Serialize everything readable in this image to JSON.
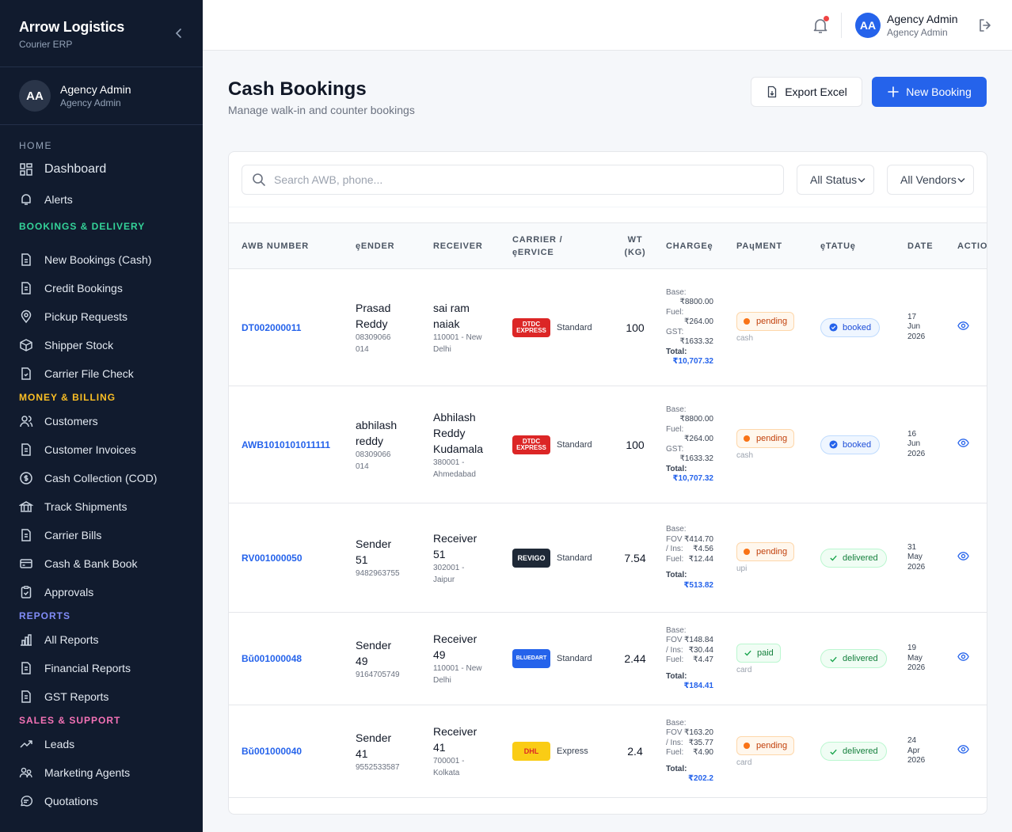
{
  "brand": {
    "title": "Arrow Logistics",
    "subtitle": "Courier ERP"
  },
  "user": {
    "initials": "AA",
    "name": "Agency Admin",
    "role": "Agency Admin"
  },
  "nav": {
    "home": "HOME",
    "dashboard": "Dashboard",
    "alerts": "Alerts",
    "bookings_section": "BOOKINGS & DELIVERY",
    "new_bookings": "New Bookings (Cash)",
    "credit_bookings": "Credit Bookings",
    "pickup_requests": "Pickup Requests",
    "shipper_stock": "Shipper Stock",
    "carrier_file_check": "Carrier File Check",
    "money_section": "MONEY & BILLING",
    "customers": "Customers",
    "customer_invoices": "Customer Invoices",
    "cash_collection": "Cash Collection (COD)",
    "track_shipments": "Track Shipments",
    "carrier_bills": "Carrier Bills",
    "cash_bank_book": "Cash & Bank Book",
    "approvals": "Approvals",
    "reports_section": "REPORTS",
    "all_reports": "All Reports",
    "financial_reports": "Financial Reports",
    "gst_reports": "GST Reports",
    "sales_section": "SALES & SUPPORT",
    "leads": "Leads",
    "marketing_agents": "Marketing Agents",
    "quotations": "Quotations"
  },
  "page": {
    "title": "Cash Bookings",
    "subtitle": "Manage walk-in and counter bookings",
    "export_label": "Export Excel",
    "new_label": "New Booking"
  },
  "filters": {
    "search_placeholder": "Search AWB, phone...",
    "status": "All Status",
    "vendors": "All Vendors"
  },
  "table": {
    "headers": {
      "awb": "AWB NUMBER",
      "sender": "ȩENDER",
      "receiver": "RECEIVER",
      "carrier_1": "CARRIER /",
      "carrier_2": "ȩERVICE",
      "wt_1": "WT",
      "wt_2": "(KG)",
      "charges": "CHARGEȩ",
      "payment": "PAɥMENT",
      "status": "ȩTATUȩ",
      "date": "DATE",
      "actions": "ACTIONS"
    },
    "rows": [
      {
        "awb": "DT002000011",
        "sender_l1": "Prasad",
        "sender_l2": "Reddy",
        "sender_p1": "08309066",
        "sender_p2": "014",
        "recv_l1": "sai ram",
        "recv_l2": "naiak",
        "recv_l3": "",
        "recv_a1": "110001 - New",
        "recv_a2": "Delhi",
        "carrier_logo_1": "DTDC",
        "carrier_logo_2": "EXPRESS",
        "service": "Standard",
        "weight": "100",
        "c1_label": "Base:",
        "c1_val": "₹8800.00",
        "c2_label": "Fuel:",
        "c2_val": "₹264.00",
        "c3_label": "GST:",
        "c3_val": "₹1633.32",
        "total_label": "Total:",
        "total": "₹10,707.32",
        "payment": "pending",
        "pay_mode": "cash",
        "status": "booked",
        "date_d": "17",
        "date_m": "Jun",
        "date_y": "2026"
      },
      {
        "awb": "AWB1010101011111",
        "sender_l1": "abhilash",
        "sender_l2": "reddy",
        "sender_p1": "08309066",
        "sender_p2": "014",
        "recv_l1": "Abhilash",
        "recv_l2": "Reddy",
        "recv_l3": "Kudamala",
        "recv_a1": "380001 -",
        "recv_a2": "Ahmedabad",
        "carrier_logo_1": "DTDC",
        "carrier_logo_2": "EXPRESS",
        "service": "Standard",
        "weight": "100",
        "c1_label": "Base:",
        "c1_val": "₹8800.00",
        "c2_label": "Fuel:",
        "c2_val": "₹264.00",
        "c3_label": "GST:",
        "c3_val": "₹1633.32",
        "total_label": "Total:",
        "total": "₹10,707.32",
        "payment": "pending",
        "pay_mode": "cash",
        "status": "booked",
        "date_d": "16",
        "date_m": "Jun",
        "date_y": "2026"
      },
      {
        "awb": "RV001000050",
        "sender_l1": "Sender",
        "sender_l2": "51",
        "sender_p1": "9482963755",
        "sender_p2": "",
        "recv_l1": "Receiver",
        "recv_l2": "51",
        "recv_l3": "",
        "recv_a1": "302001 -",
        "recv_a2": "Jaipur",
        "carrier_logo_1": "REVIGO",
        "carrier_logo_2": "",
        "service": "Standard",
        "weight": "7.54",
        "c1_label": "Base:",
        "c1_val": "",
        "c2_label": "FOV",
        "c2_val": "₹414.70",
        "c3_label": "/ Ins:",
        "c3_val": "₹4.56",
        "c4_label": "Fuel:",
        "c4_val": "₹12.44",
        "total_label": "Total:",
        "total": "₹513.82",
        "payment": "pending",
        "pay_mode": "upi",
        "status": "delivered",
        "date_d": "31",
        "date_m": "May",
        "date_y": "2026"
      },
      {
        "awb": "Bǔ001000048",
        "sender_l1": "Sender",
        "sender_l2": "49",
        "sender_p1": "9164705749",
        "sender_p2": "",
        "recv_l1": "Receiver",
        "recv_l2": "49",
        "recv_l3": "",
        "recv_a1": "110001 - New",
        "recv_a2": "Delhi",
        "carrier_logo_1": "BLUEDART",
        "carrier_logo_2": "",
        "service": "Standard",
        "weight": "2.44",
        "c1_label": "Base:",
        "c1_val": "",
        "c2_label": "FOV",
        "c2_val": "₹148.84",
        "c3_label": "/ Ins:",
        "c3_val": "₹30.44",
        "c4_label": "Fuel:",
        "c4_val": "₹4.47",
        "total_label": "Total:",
        "total": "₹184.41",
        "payment": "paid",
        "pay_mode": "card",
        "status": "delivered",
        "date_d": "19",
        "date_m": "May",
        "date_y": "2026"
      },
      {
        "awb": "Bǔ001000040",
        "sender_l1": "Sender",
        "sender_l2": "41",
        "sender_p1": "9552533587",
        "sender_p2": "",
        "recv_l1": "Receiver",
        "recv_l2": "41",
        "recv_l3": "",
        "recv_a1": "700001 -",
        "recv_a2": "Kolkata",
        "carrier_logo_1": "DHL",
        "carrier_logo_2": "",
        "service": "Express",
        "weight": "2.4",
        "c1_label": "Base:",
        "c1_val": "",
        "c2_label": "FOV",
        "c2_val": "₹163.20",
        "c3_label": "/ Ins:",
        "c3_val": "₹35.77",
        "c4_label": "Fuel:",
        "c4_val": "₹4.90",
        "total_label": "Total:",
        "total": "₹202.2",
        "payment": "pending",
        "pay_mode": "card",
        "status": "delivered",
        "date_d": "24",
        "date_m": "Apr",
        "date_y": "2026"
      }
    ]
  },
  "colors": {
    "sidebar_bg": "#111b2e",
    "primary": "#2563eb",
    "dtdc": "#dc2626",
    "revigo": "#1f2937",
    "bluedart": "#2563eb",
    "dhl": "#facc15"
  }
}
